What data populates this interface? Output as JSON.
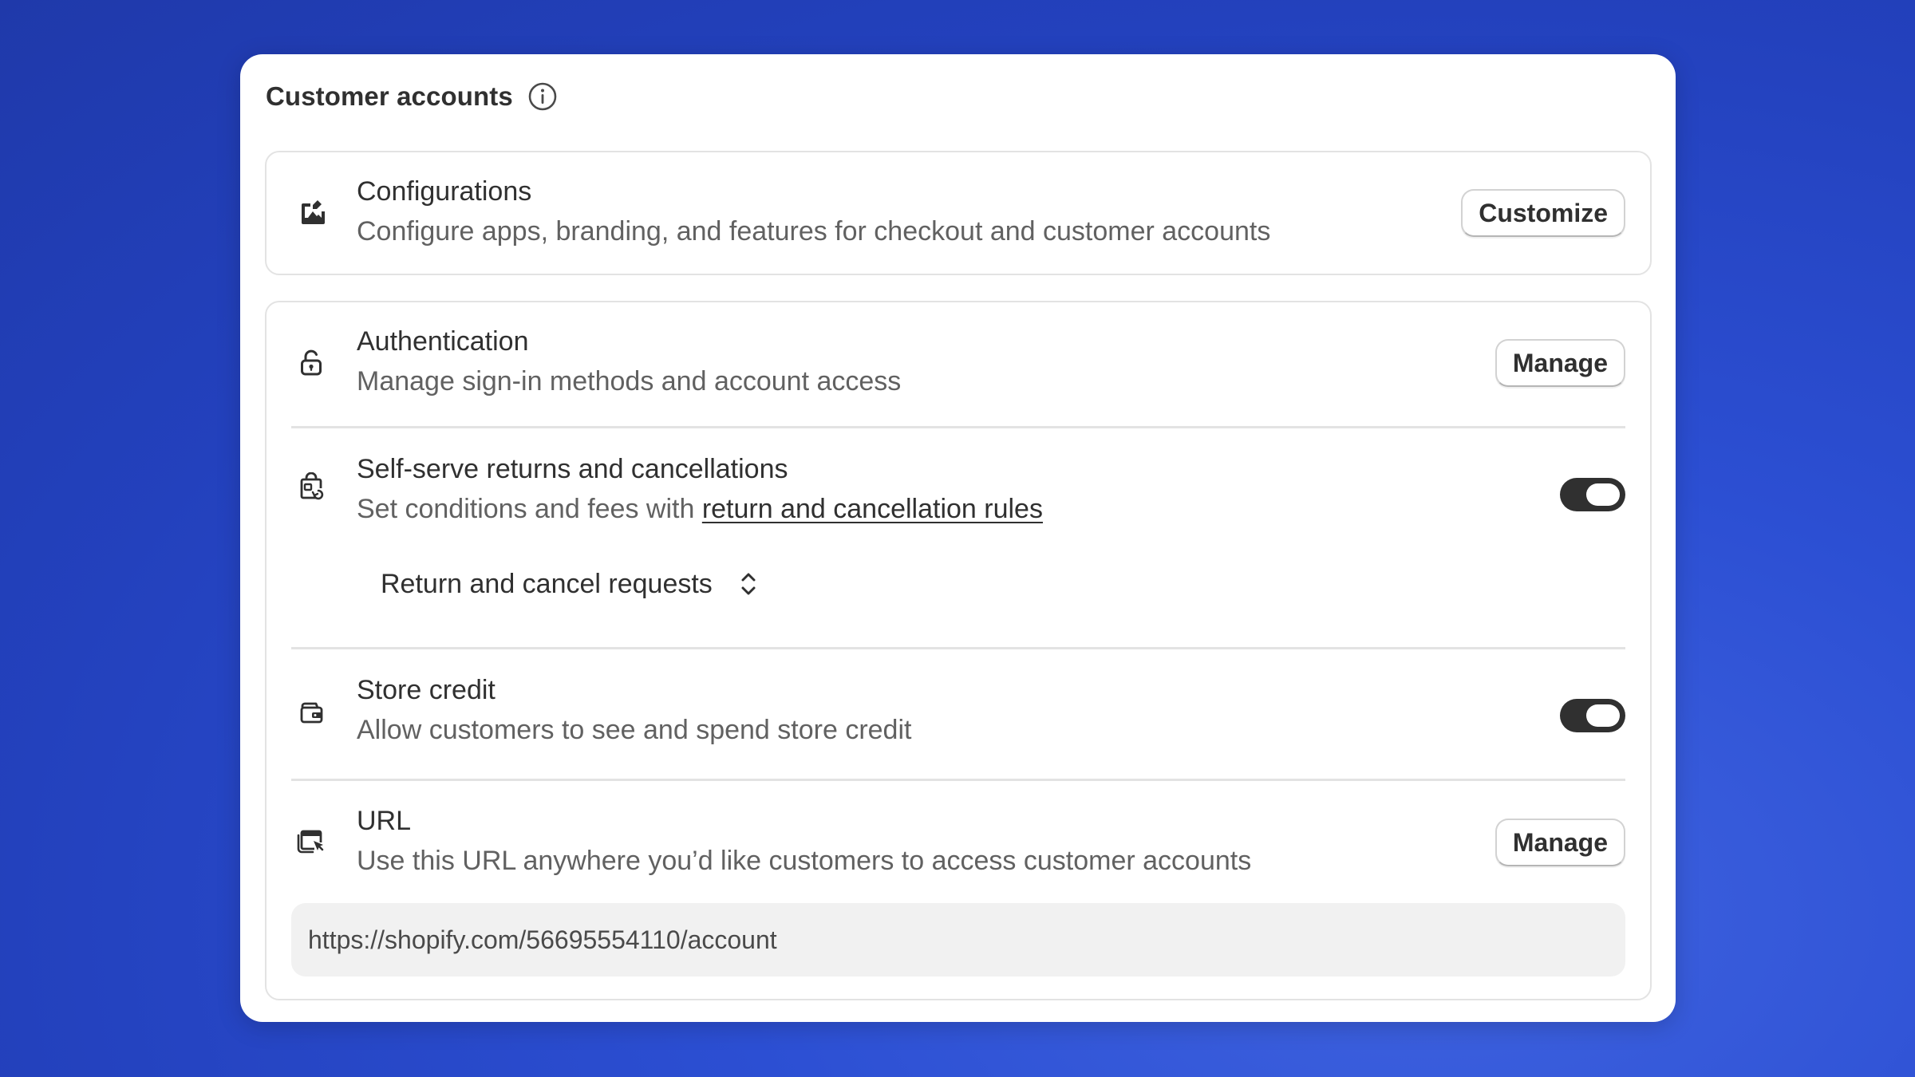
{
  "card": {
    "title": "Customer accounts"
  },
  "configurations": {
    "title": "Configurations",
    "description": "Configure apps, branding, and features for checkout and customer accounts",
    "button_label": "Customize"
  },
  "authentication": {
    "title": "Authentication",
    "description": "Manage sign-in methods and account access",
    "button_label": "Manage"
  },
  "self_serve": {
    "title": "Self-serve returns and cancellations",
    "description_prefix": "Set conditions and fees with ",
    "link_text": "return and cancellation rules",
    "toggle_on": true,
    "select_value": "Return and cancel requests"
  },
  "store_credit": {
    "title": "Store credit",
    "description": "Allow customers to see and spend store credit",
    "toggle_on": true
  },
  "url": {
    "title": "URL",
    "description": "Use this URL anywhere you’d like customers to access customer accounts",
    "button_label": "Manage",
    "value": "https://shopify.com/56695554110/account"
  },
  "colors": {
    "background": "#2341bd",
    "card": "#ffffff",
    "text_primary": "#303030",
    "text_secondary": "#616161",
    "toggle_on": "#303030",
    "field_bg": "#f1f1f1"
  },
  "icons": {
    "header": "info-icon",
    "configurations": "image-edit-icon",
    "authentication": "lock-icon",
    "self_serve": "return-icon",
    "store_credit": "wallet-icon",
    "url": "browser-cursor-icon",
    "select": "chevron-up-down-icon"
  }
}
